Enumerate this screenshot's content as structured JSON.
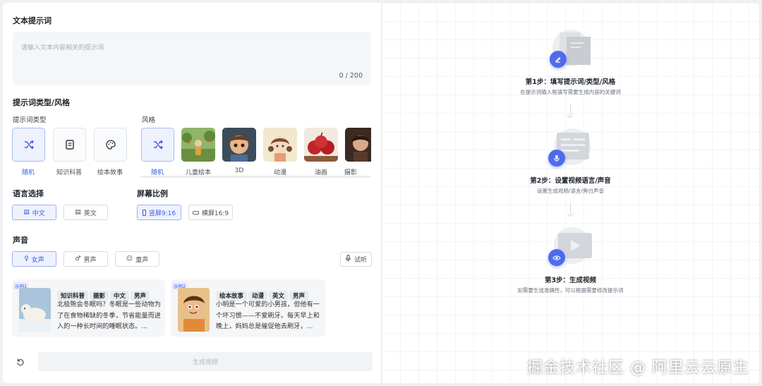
{
  "prompt": {
    "title": "文本提示词",
    "placeholder": "请输入文本内容相关的提示词",
    "counter": "0 / 200"
  },
  "prompt_style": {
    "title": "提示词类型/风格",
    "type_label": "提示词类型",
    "types": [
      {
        "label": "随机",
        "icon": "shuffle-icon",
        "selected": true
      },
      {
        "label": "知识科普",
        "icon": "document-icon",
        "selected": false
      },
      {
        "label": "绘本故事",
        "icon": "palette-icon",
        "selected": false
      }
    ],
    "style_label": "风格",
    "styles": [
      {
        "label": "随机",
        "icon": "shuffle-icon",
        "selected": true
      },
      {
        "label": "儿童绘本",
        "icon": "children-picture-book-thumbnail",
        "selected": false
      },
      {
        "label": "3D",
        "icon": "3d-boy-thumbnail",
        "selected": false
      },
      {
        "label": "动漫",
        "icon": "anime-girl-thumbnail",
        "selected": false
      },
      {
        "label": "油画",
        "icon": "oil-painting-apples-thumbnail",
        "selected": false
      },
      {
        "label": "摄影",
        "icon": "photo-girl-thumbnail",
        "selected": false
      }
    ]
  },
  "language": {
    "title": "语言选择",
    "options": [
      {
        "label": "中文",
        "icon": "text-icon",
        "selected": true
      },
      {
        "label": "英文",
        "icon": "text-icon",
        "selected": false
      }
    ]
  },
  "ratio": {
    "title": "屏幕比例",
    "options": [
      {
        "label": "竖屏9:16",
        "icon": "portrait-icon",
        "selected": true
      },
      {
        "label": "横屏16:9",
        "icon": "landscape-icon",
        "selected": false
      }
    ]
  },
  "voice": {
    "title": "声音",
    "options": [
      {
        "label": "女声",
        "icon": "female-icon",
        "selected": true
      },
      {
        "label": "男声",
        "icon": "male-icon",
        "selected": false
      },
      {
        "label": "童声",
        "icon": "child-icon",
        "selected": false
      }
    ],
    "listen_label": "试听"
  },
  "examples": [
    {
      "badge": "示例1",
      "tags": [
        "知识科普",
        "摄影",
        "中文",
        "男声"
      ],
      "text": "北极熊会冬眠吗？冬眠是一些动物为了在食物稀缺的冬季，节省能量而进入的一种长时间的睡眠状态。..."
    },
    {
      "badge": "示例2",
      "tags": [
        "绘本故事",
        "动漫",
        "英文",
        "男声"
      ],
      "text": "小明是一个可爱的小男孩，但他有一个坏习惯——不爱刷牙。每天早上和晚上，妈妈总是催促他去刷牙，..."
    }
  ],
  "actions": {
    "generate_label": "生成视频"
  },
  "steps": [
    {
      "title": "第1步：填写提示词/类型/风格",
      "subtitle": "在提示词输入框填写需要生成内容的关键词",
      "icon": "pen-icon"
    },
    {
      "title": "第2步：设置视频语言/声音",
      "subtitle": "设置生成视频/语言/旁白声音",
      "icon": "microphone-icon"
    },
    {
      "title": "第3步：生成视频",
      "subtitle": "如需要生成准确性，可以根据需要修改提示词",
      "icon": "eye-icon"
    }
  ],
  "watermark": "掘金技术社区 @ 阿里云云原生",
  "colors": {
    "accent": "#3b5bdb",
    "accent_bg": "#eef2ff",
    "step_icon": "#4f6bed"
  }
}
